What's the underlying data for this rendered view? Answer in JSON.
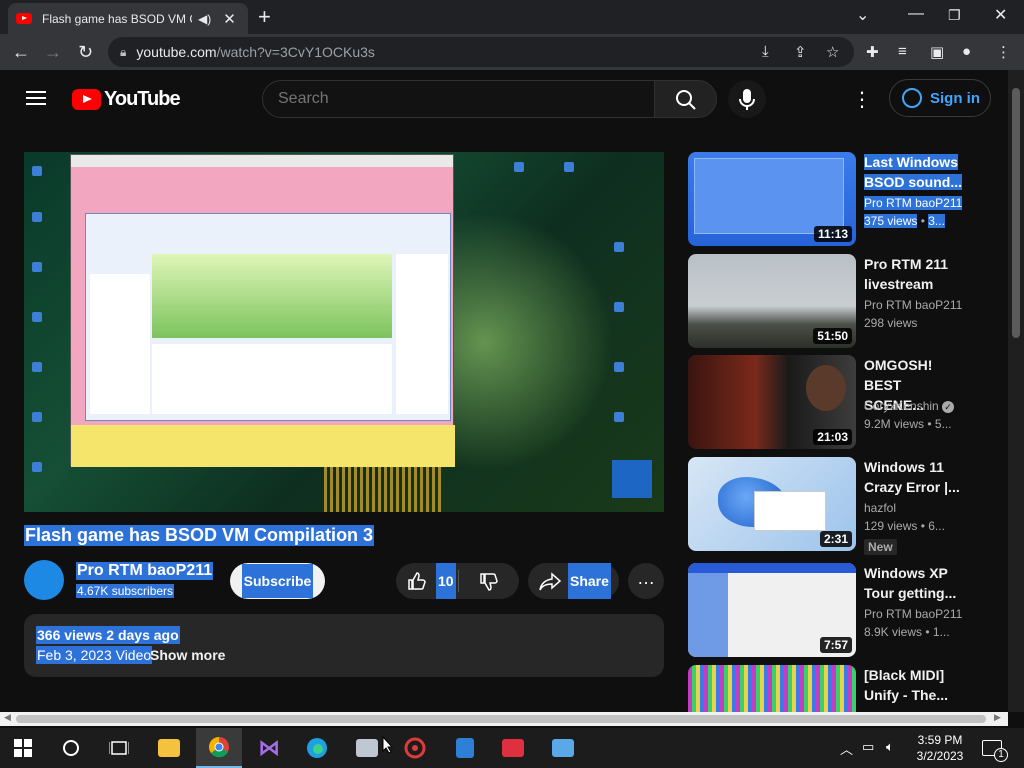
{
  "browser": {
    "tab_title": "Flash game has BSOD VM Co",
    "url_host": "youtube.com",
    "url_path": "/watch?v=3CvY1OCKu3s"
  },
  "header": {
    "logo_text": "YouTube",
    "search_placeholder": "Search",
    "signin_label": "Sign in"
  },
  "video": {
    "title": "Flash game has BSOD VM Compilation 3",
    "channel": "Pro RTM baoP211",
    "subscribers": "4.67K subscribers",
    "subscribe_label": "Subscribe",
    "likes": "10",
    "share_label": "Share",
    "views_date": "366 views  2 days ago",
    "description_line": "Feb 3, 2023 Video",
    "show_more": "Show more"
  },
  "recommendations": [
    {
      "title": "Last Windows BSOD sound...",
      "channel": "Pro RTM baoP211",
      "views": "375 views",
      "age": "3...",
      "duration": "11:13",
      "selected": true
    },
    {
      "title": "Pro RTM 211 livestream",
      "channel": "Pro RTM baoP211",
      "views": "298 views",
      "age": "",
      "duration": "51:50"
    },
    {
      "title": "OMGOSH! BEST SCENE...",
      "channel": "CoryxKenshin",
      "views": "9.2M views",
      "age": "5...",
      "duration": "21:03",
      "verified": true
    },
    {
      "title": "Windows 11 Crazy Error |...",
      "channel": "hazfol",
      "views": "129 views",
      "age": "6...",
      "duration": "2:31",
      "badge": "New"
    },
    {
      "title": "Windows XP Tour getting...",
      "channel": "Pro RTM baoP211",
      "views": "8.9K views",
      "age": "1...",
      "duration": "7:57"
    },
    {
      "title": "[Black MIDI] Unify - The...",
      "channel": "",
      "views": "",
      "age": "",
      "duration": ""
    }
  ],
  "taskbar": {
    "time": "3:59 PM",
    "date": "3/2/2023",
    "notification_count": "1"
  },
  "colors": {
    "selection": "#2d72d8",
    "yt_red": "#ff0000",
    "link_blue": "#3ea6ff"
  }
}
